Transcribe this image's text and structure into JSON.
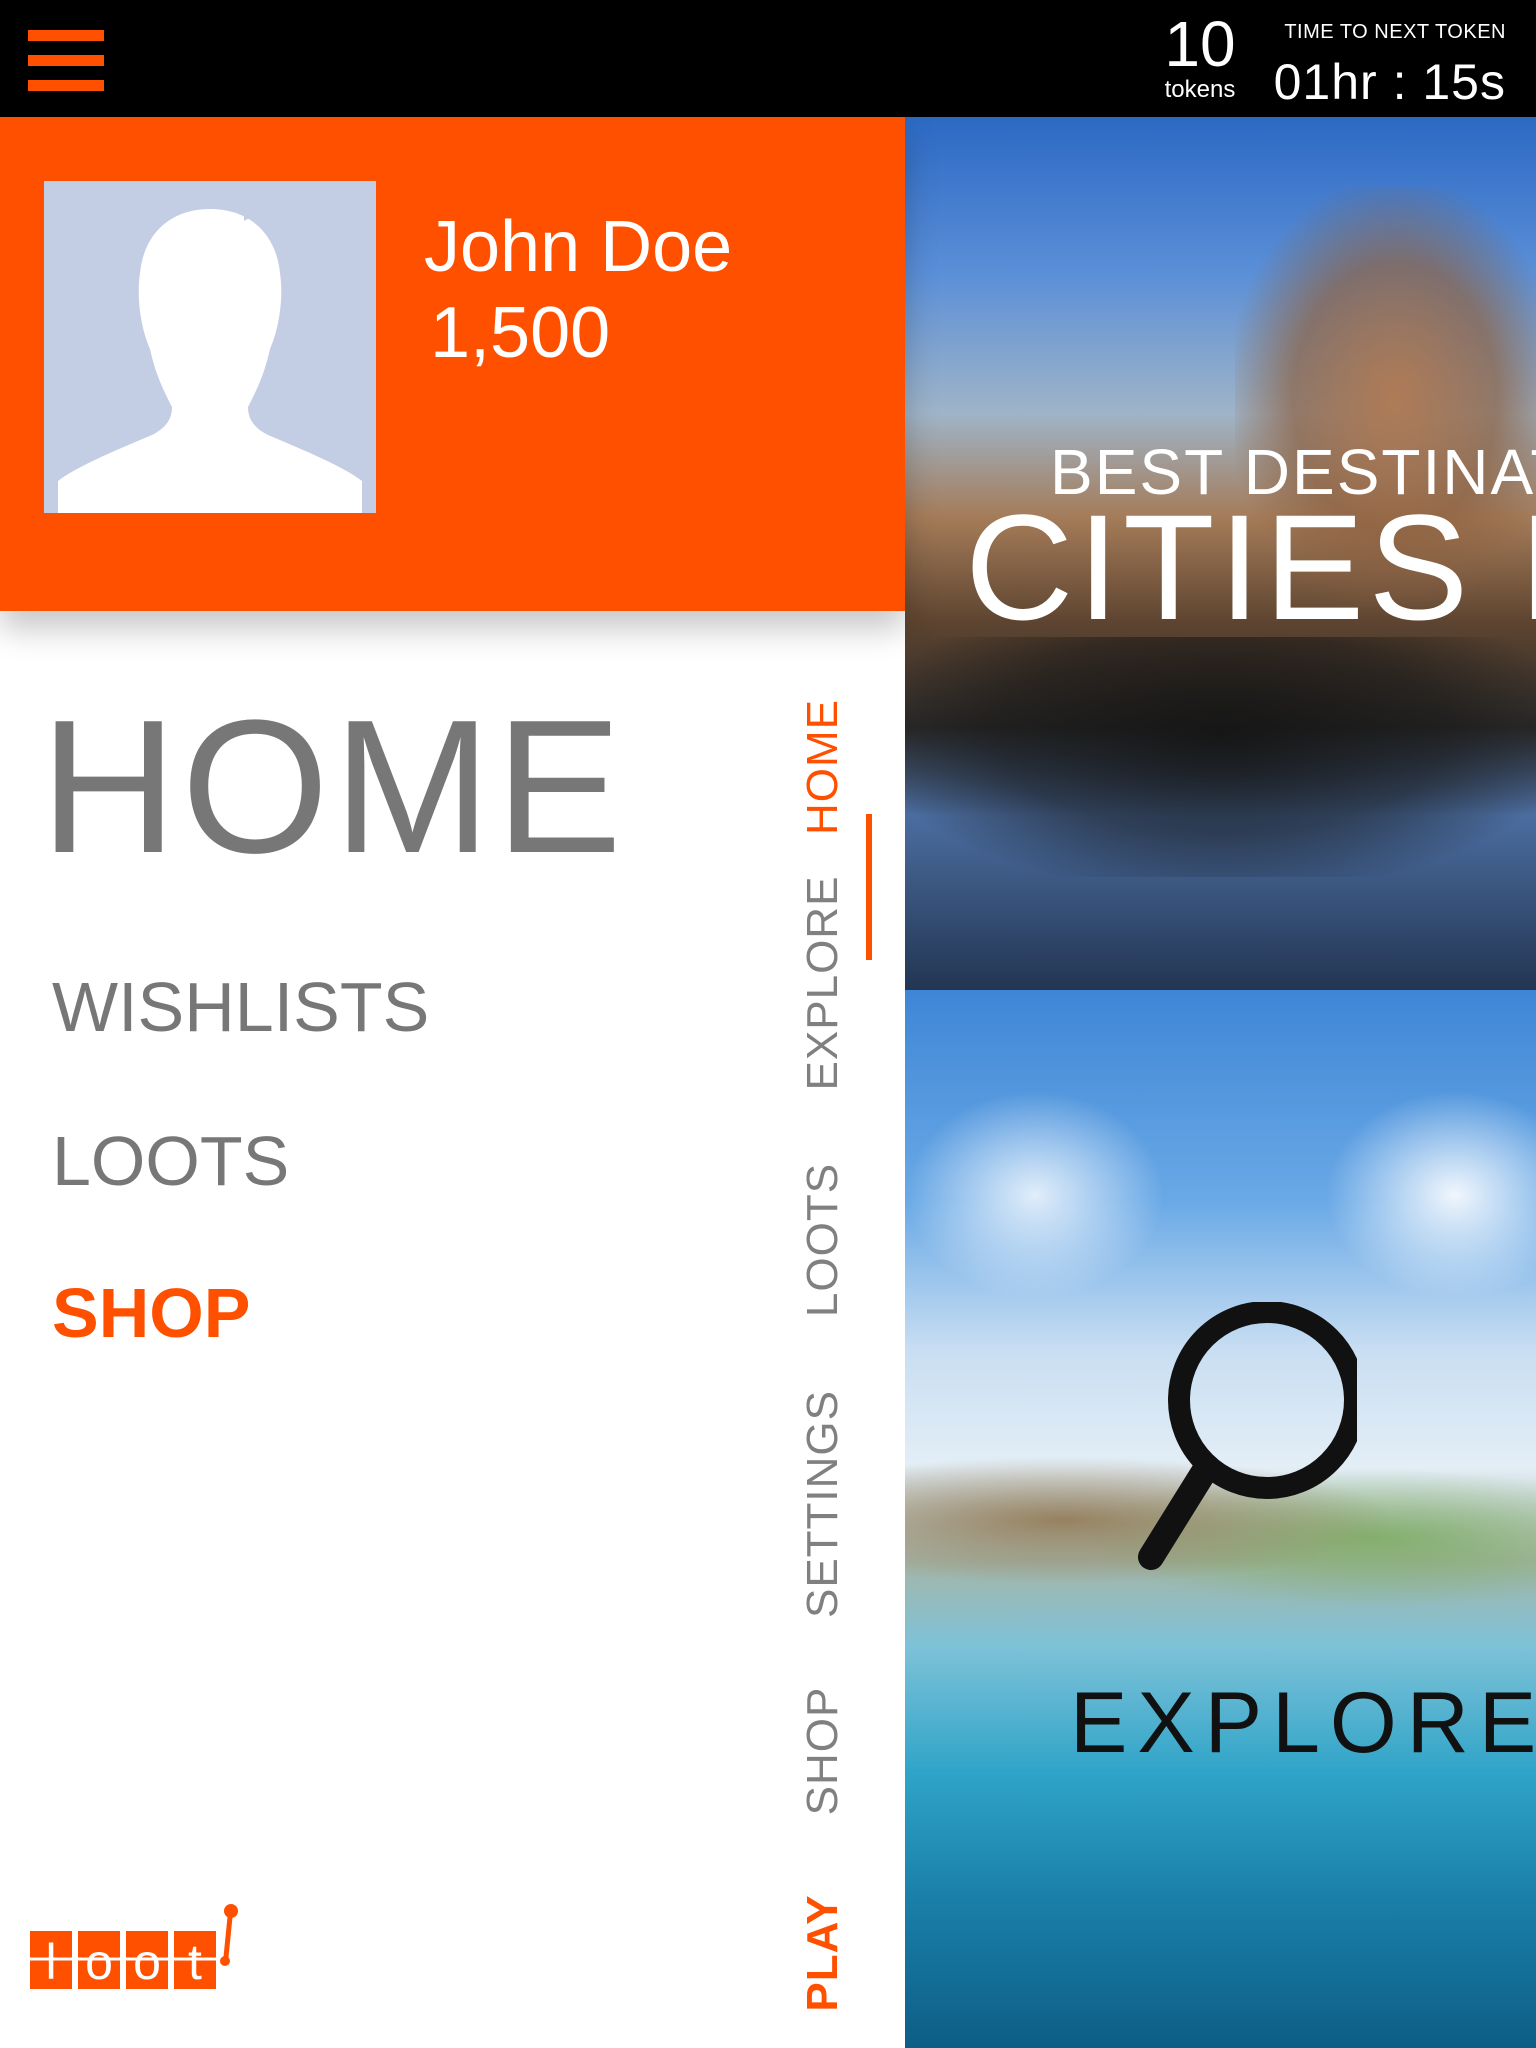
{
  "topbar": {
    "tokens_count": "10",
    "tokens_label": "tokens",
    "timer_label": "TIME TO NEXT TOKEN",
    "timer_value": "01hr : 15s"
  },
  "profile": {
    "name": "John Doe",
    "points": "1,500"
  },
  "page": {
    "title": "HOME"
  },
  "menu": {
    "items": [
      {
        "label": "WISHLISTS"
      },
      {
        "label": "LOOTS"
      },
      {
        "label": "SHOP"
      }
    ]
  },
  "vertical_nav": {
    "items": [
      {
        "label": "HOME"
      },
      {
        "label": "EXPLORE"
      },
      {
        "label": "LOOTS"
      },
      {
        "label": "SETTINGS"
      },
      {
        "label": "SHOP"
      },
      {
        "label": "PLAY"
      }
    ]
  },
  "tiles": {
    "cities_line1": "BEST DESTINAT",
    "cities_line2": "CITIES I",
    "explore_label": "EXPLORE"
  },
  "logo": {
    "text": "loot"
  },
  "colors": {
    "accent": "#ff5000",
    "topbar": "#000000",
    "text_gray": "#777777",
    "avatar_bg": "#c3cde3"
  }
}
